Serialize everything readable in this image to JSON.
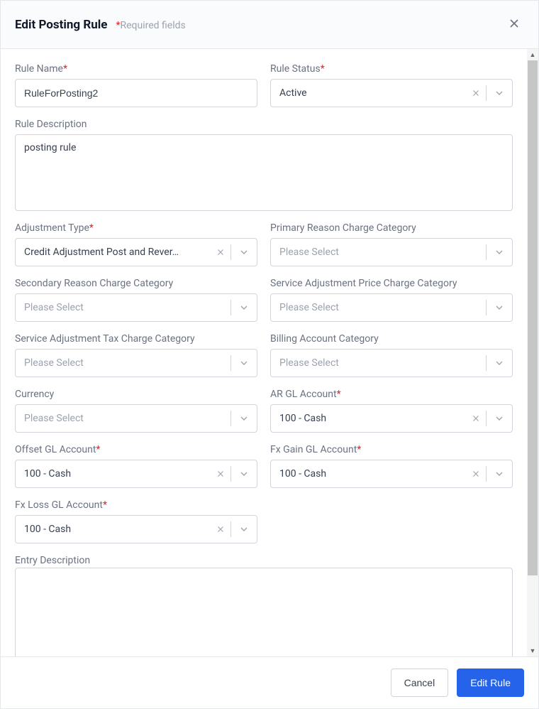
{
  "header": {
    "title": "Edit Posting Rule",
    "required_note": "Required fields"
  },
  "labels": {
    "rule_name": "Rule Name",
    "rule_status": "Rule Status",
    "rule_description": "Rule Description",
    "adjustment_type": "Adjustment Type",
    "primary_reason": "Primary Reason Charge Category",
    "secondary_reason": "Secondary Reason Charge Category",
    "service_adj_price": "Service Adjustment Price Charge Category",
    "service_adj_tax": "Service Adjustment Tax Charge Category",
    "billing_account_cat": "Billing Account Category",
    "currency": "Currency",
    "ar_gl": "AR GL Account",
    "offset_gl": "Offset GL Account",
    "fx_gain_gl": "Fx Gain GL Account",
    "fx_loss_gl": "Fx Loss GL Account",
    "entry_description": "Entry Description"
  },
  "values": {
    "rule_name": "RuleForPosting2",
    "rule_status": "Active",
    "rule_description": "posting rule",
    "adjustment_type": "Credit Adjustment Post and Rever…",
    "ar_gl": "100 - Cash",
    "offset_gl": "100 - Cash",
    "fx_gain_gl": "100 - Cash",
    "fx_loss_gl": "100 - Cash",
    "entry_description": ""
  },
  "placeholders": {
    "please_select": "Please Select"
  },
  "footer": {
    "cancel": "Cancel",
    "submit": "Edit Rule"
  }
}
